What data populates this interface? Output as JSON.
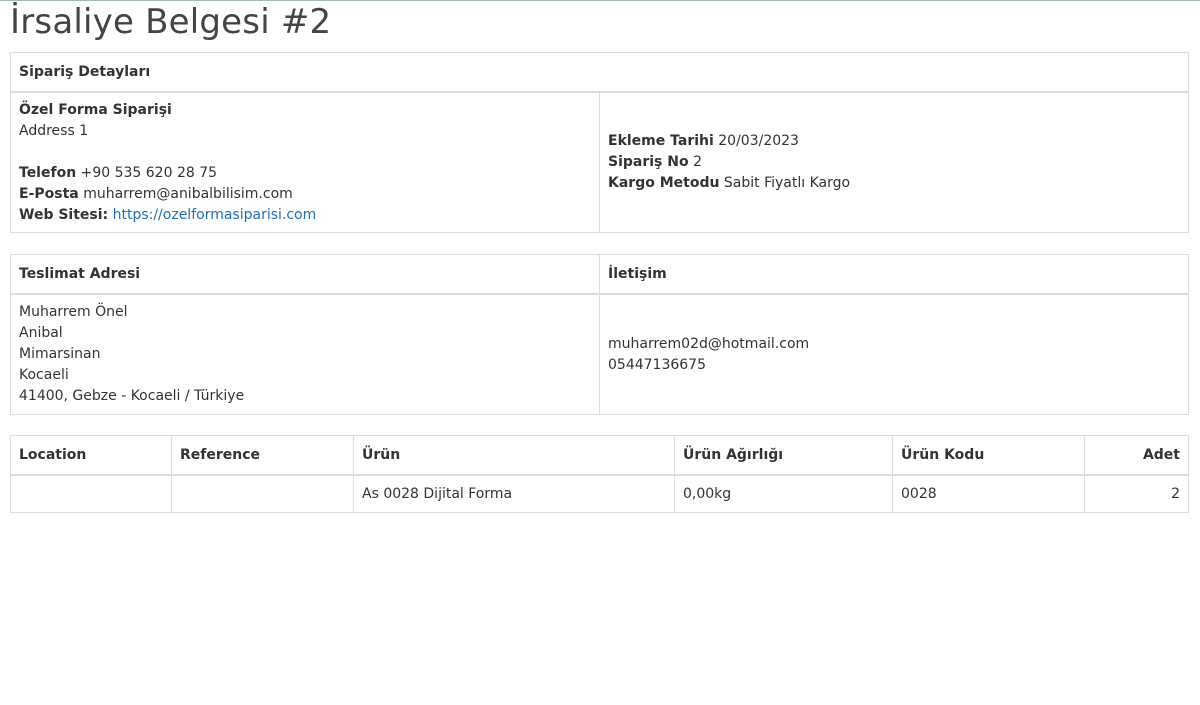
{
  "title": "İrsaliye Belgesi #2",
  "order_details": {
    "header": "Sipariş Detayları",
    "store_name": "Özel Forma Siparişi",
    "address": "Address 1",
    "phone_label": "Telefon",
    "phone": "+90 535 620 28 75",
    "email_label": "E-Posta",
    "email": "muharrem@anibalbilisim.com",
    "website_label": "Web Sitesi:",
    "website": "https://ozelformasiparisi.com",
    "date_label": "Ekleme Tarihi",
    "date": "20/03/2023",
    "order_no_label": "Sipariş No",
    "order_no": "2",
    "shipping_label": "Kargo Metodu",
    "shipping": "Sabit Fiyatlı Kargo"
  },
  "delivery": {
    "address_header": "Teslimat Adresi",
    "contact_header": "İletişim",
    "address_lines": [
      "Muharrem Önel",
      "Anibal",
      "Mimarsinan",
      "Kocaeli",
      "41400, Gebze - Kocaeli / Türkiye"
    ],
    "contact_email": "muharrem02d@hotmail.com",
    "contact_phone": "05447136675"
  },
  "products": {
    "columns": [
      "Location",
      "Reference",
      "Ürün",
      "Ürün Ağırlığı",
      "Ürün Kodu",
      "Adet"
    ],
    "rows": [
      [
        "",
        "",
        "As 0028 Dijital Forma",
        "0,00kg",
        "0028",
        "2"
      ]
    ]
  }
}
